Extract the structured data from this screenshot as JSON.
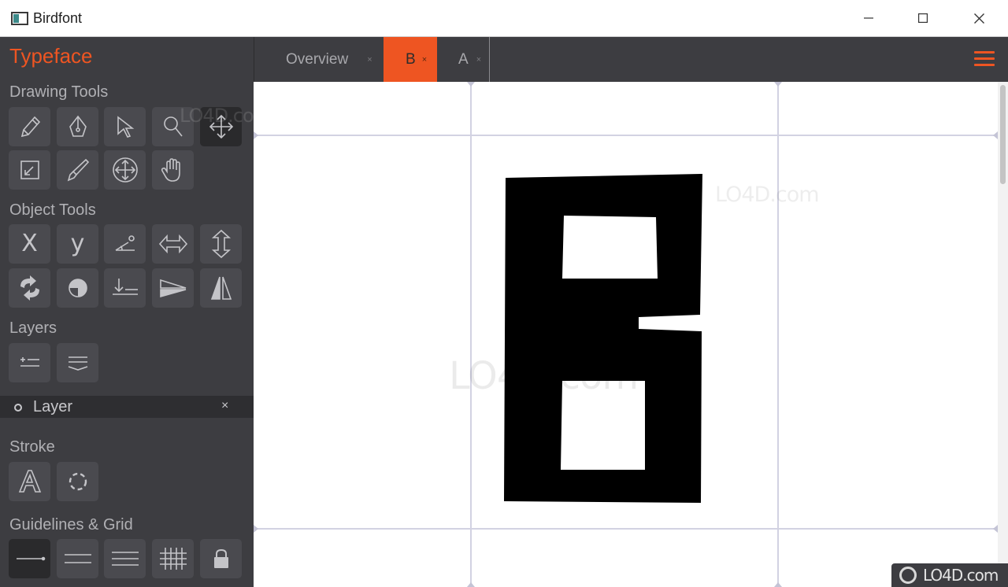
{
  "window": {
    "title": "Birdfont",
    "controls": {
      "minimize": "minimize",
      "maximize": "maximize",
      "close": "close"
    }
  },
  "sidebar": {
    "typeface_label": "Typeface",
    "sections": {
      "drawing_tools": "Drawing Tools",
      "object_tools": "Object Tools",
      "layers": "Layers",
      "stroke": "Stroke",
      "guidelines_grid": "Guidelines & Grid"
    },
    "drawing_tools": [
      "pen-icon",
      "point-tool-icon",
      "select-arrow-icon",
      "zoom-icon",
      "move-icon",
      "resize-icon",
      "brush-icon",
      "move-point-icon",
      "hand-icon"
    ],
    "object_tools": {
      "x_label": "X",
      "y_label": "y",
      "icons": [
        "rotate-angle-icon",
        "flip-horizontal-icon",
        "flip-vertical-icon",
        "reverse-path-icon",
        "fill-icon",
        "baseline-icon",
        "skew-icon",
        "mirror-icon"
      ]
    },
    "layer_tools": [
      "add-layer-icon",
      "layers-list-icon"
    ],
    "layer": {
      "name": "Layer",
      "close": "×"
    },
    "stroke_tools": [
      "stroke-icon",
      "circle-stroke-icon"
    ],
    "guideline_tools": [
      "guideline-icon",
      "double-guideline-icon",
      "triple-guideline-icon",
      "grid-icon",
      "lock-icon"
    ]
  },
  "tabs": [
    {
      "label": "Overview",
      "close": "×",
      "active": false
    },
    {
      "label": "B",
      "close": "×",
      "active": true
    },
    {
      "label": "A",
      "close": "×",
      "active": false
    }
  ],
  "colors": {
    "accent": "#ee5522",
    "sidebar_bg": "#3d3d41",
    "guide": "#cfcfe0",
    "glyph": "#000000"
  },
  "watermark": {
    "text": "LO4D.com"
  }
}
